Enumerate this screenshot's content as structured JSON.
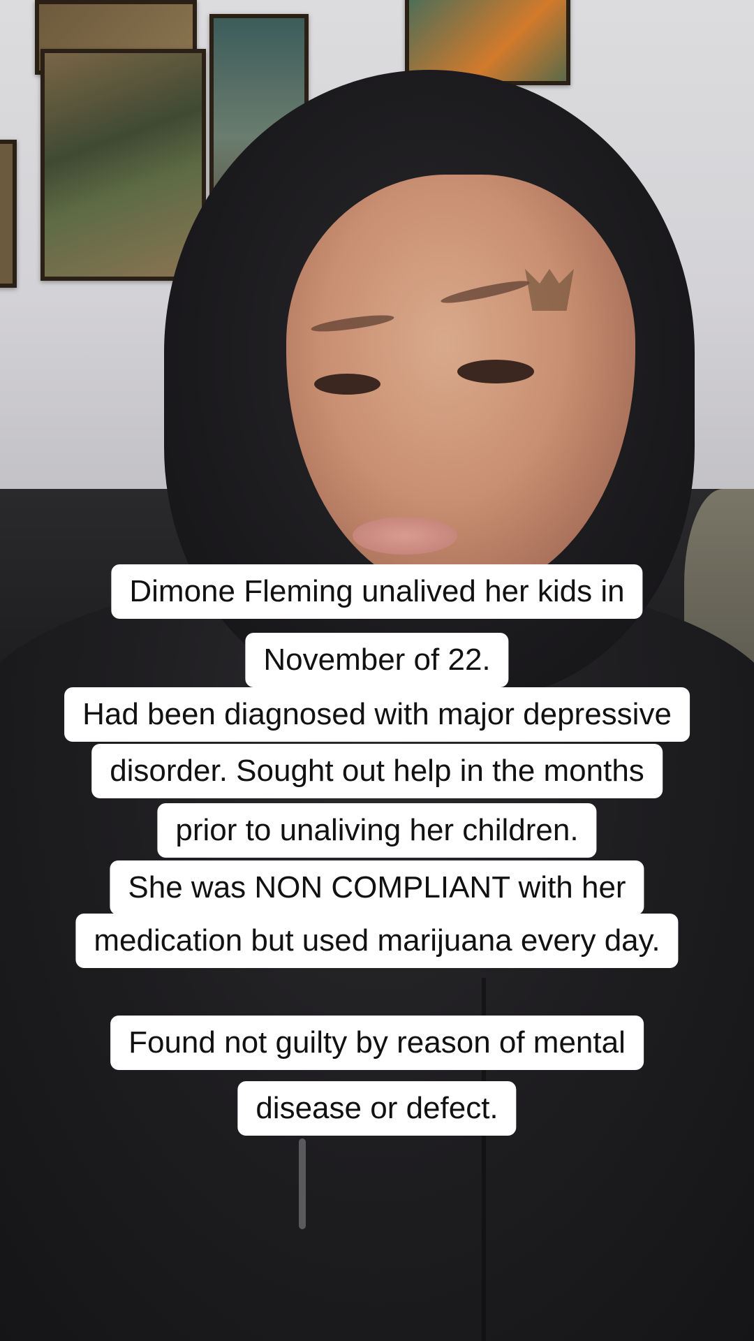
{
  "caption": {
    "lines": [
      "Dimone Fleming unalived her kids in",
      "November of 22.",
      "Had been diagnosed with major depressive",
      "disorder. Sought out help in the months",
      "prior to unaliving her children.",
      "She was NON COMPLIANT  with her",
      "medication but used marijuana every day.",
      "Found not guilty by reason of mental",
      "disease or defect."
    ]
  },
  "colors": {
    "caption_background": "#ffffff",
    "caption_text": "#111111"
  }
}
